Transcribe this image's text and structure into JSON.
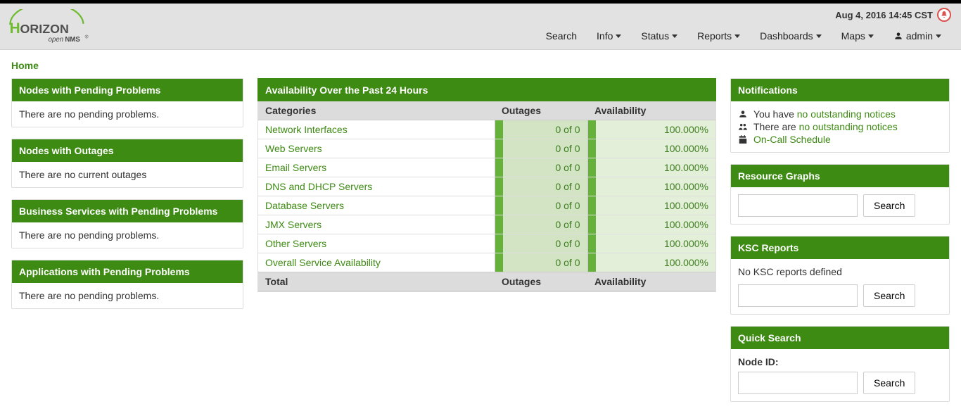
{
  "clock_text": "Aug 4, 2016 14:45 CST",
  "nav": {
    "search": "Search",
    "info": "Info",
    "status": "Status",
    "reports": "Reports",
    "dashboards": "Dashboards",
    "maps": "Maps",
    "user": "admin"
  },
  "breadcrumb": {
    "home": "Home"
  },
  "left": {
    "pending_nodes": {
      "title": "Nodes with Pending Problems",
      "text": "There are no pending problems."
    },
    "outages": {
      "title": "Nodes with Outages",
      "text": "There are no current outages"
    },
    "pending_bs": {
      "title": "Business Services with Pending Problems",
      "text": "There are no pending problems."
    },
    "pending_apps": {
      "title": "Applications with Pending Problems",
      "text": "There are no pending problems."
    }
  },
  "avail": {
    "title": "Availability Over the Past 24 Hours",
    "col_categories": "Categories",
    "col_outages": "Outages",
    "col_availability": "Availability",
    "rows": [
      {
        "name": "Network Interfaces",
        "outage": "0 of 0",
        "avail": "100.000%"
      },
      {
        "name": "Web Servers",
        "outage": "0 of 0",
        "avail": "100.000%"
      },
      {
        "name": "Email Servers",
        "outage": "0 of 0",
        "avail": "100.000%"
      },
      {
        "name": "DNS and DHCP Servers",
        "outage": "0 of 0",
        "avail": "100.000%"
      },
      {
        "name": "Database Servers",
        "outage": "0 of 0",
        "avail": "100.000%"
      },
      {
        "name": "JMX Servers",
        "outage": "0 of 0",
        "avail": "100.000%"
      },
      {
        "name": "Other Servers",
        "outage": "0 of 0",
        "avail": "100.000%"
      }
    ],
    "footer_total": "Total",
    "footer_outages": "Outages",
    "footer_avail": "Availability",
    "overall_row": {
      "name": "Overall Service Availability",
      "outage": "0 of 0",
      "avail": "100.000%"
    }
  },
  "notifications": {
    "title": "Notifications",
    "you_prefix": "You have ",
    "you_link": "no outstanding notices",
    "there_prefix": "There are ",
    "there_link": "no outstanding notices",
    "oncall": "On-Call Schedule"
  },
  "rgraphs": {
    "title": "Resource Graphs",
    "btn": "Search"
  },
  "ksc": {
    "title": "KSC Reports",
    "none": "No KSC reports defined",
    "btn": "Search"
  },
  "quick": {
    "title": "Quick Search",
    "label_node_id": "Node ID:",
    "btn": "Search"
  }
}
